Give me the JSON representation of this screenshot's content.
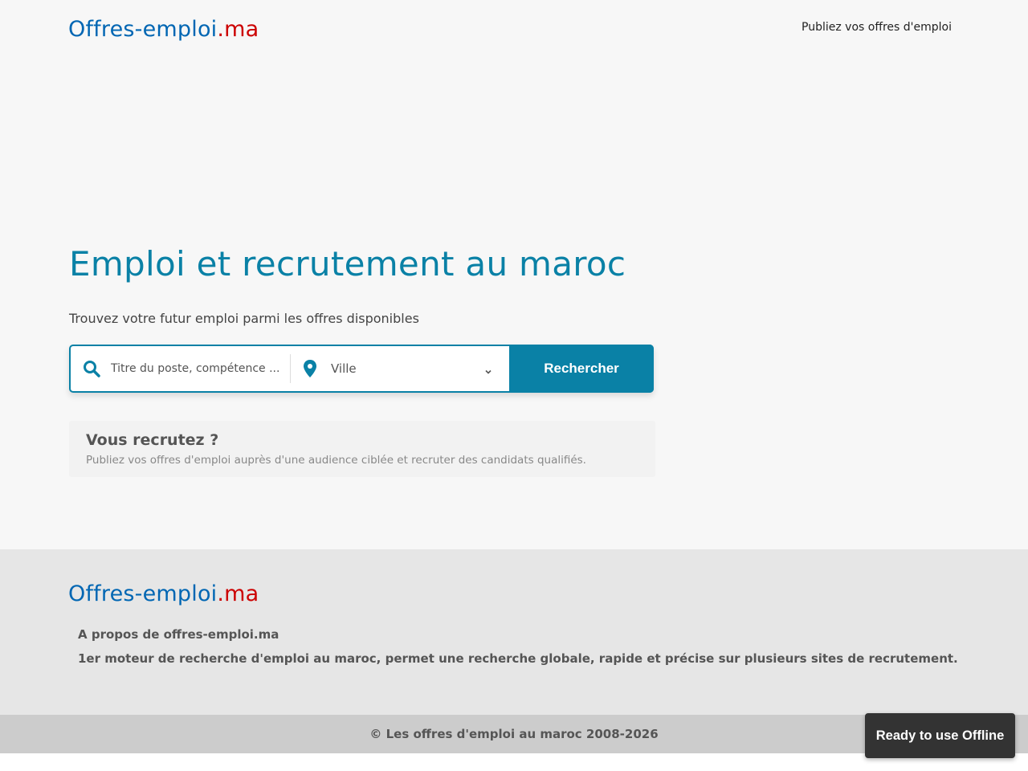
{
  "header": {
    "logo_main": "Offres-emploi",
    "logo_tld": ".ma",
    "publish_link": "Publiez vos offres d'emploi"
  },
  "hero": {
    "title": "Emploi et recrutement au maroc",
    "subtitle": "Trouvez votre futur emploi parmi les offres disponibles"
  },
  "search": {
    "keyword_placeholder": "Titre du poste, compétence ...",
    "city_value": "Ville",
    "button_label": "Rechercher"
  },
  "recruit": {
    "title": "Vous recrutez ?",
    "text": "Publiez vos offres d'emploi auprès d'une audience ciblée et recruter des candidats qualifiés."
  },
  "footer": {
    "logo_main": "Offres-emploi",
    "logo_tld": ".ma",
    "about_title": "A propos de offres-emploi.ma",
    "about_text": "1er moteur de recherche d'emploi au maroc, permet une recherche globale, rapide et précise sur plusieurs sites de recrutement.",
    "copyright": "© Les offres d'emploi au maroc 2008-2026"
  },
  "toast": {
    "label": "Ready to use Offline"
  },
  "colors": {
    "accent": "#0a81a6",
    "logo_blue": "#0066b3",
    "logo_red": "#cc0000"
  },
  "icons": {
    "search": "search-icon",
    "location": "map-pin-icon",
    "dropdown": "chevron-down-icon"
  }
}
